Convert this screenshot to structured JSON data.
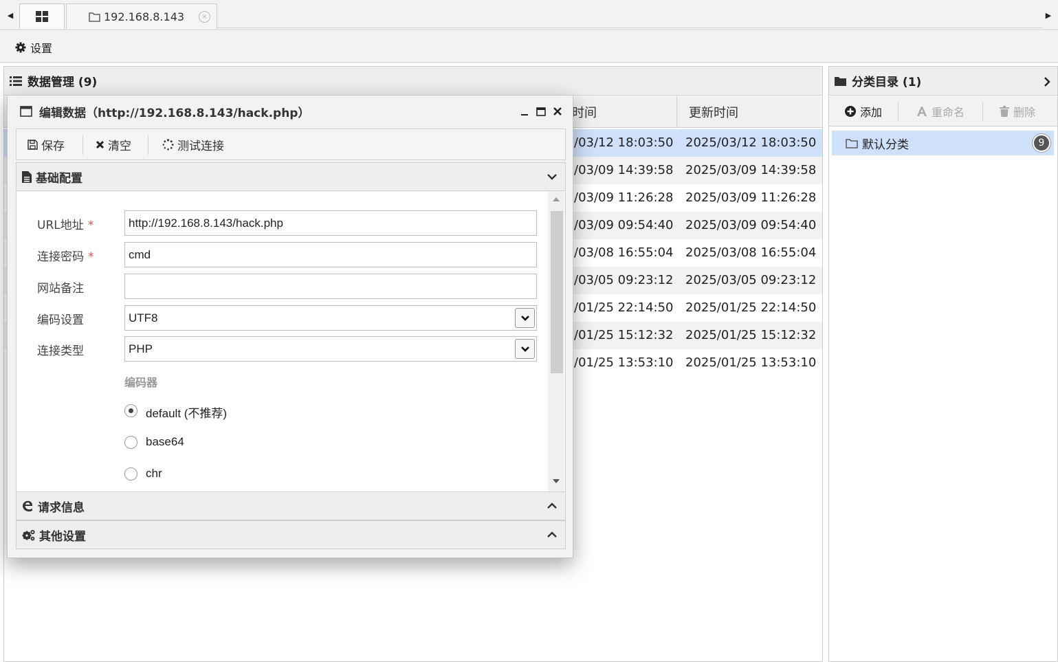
{
  "tabs": {
    "home_icon": "grid-icon",
    "host_label": "192.168.8.143",
    "close_symbol": "×"
  },
  "settings": {
    "label": "设置"
  },
  "data_panel": {
    "title": "数据管理 (9)",
    "col_created_partial": "时间",
    "col_updated": "更新时间",
    "rows": [
      {
        "created": "/03/12 18:03:50",
        "updated": "2025/03/12 18:03:50",
        "selected": true
      },
      {
        "created": "/03/09 14:39:58",
        "updated": "2025/03/09 14:39:58"
      },
      {
        "created": "/03/09 11:26:28",
        "updated": "2025/03/09 11:26:28"
      },
      {
        "created": "/03/09 09:54:40",
        "updated": "2025/03/09 09:54:40"
      },
      {
        "created": "/03/08 16:55:04",
        "updated": "2025/03/08 16:55:04"
      },
      {
        "created": "/03/05 09:23:12",
        "updated": "2025/03/05 09:23:12"
      },
      {
        "created": "/01/25 22:14:50",
        "updated": "2025/01/25 22:14:50"
      },
      {
        "created": "/01/25 15:12:32",
        "updated": "2025/01/25 15:12:32"
      },
      {
        "created": "/01/25 13:53:10",
        "updated": "2025/01/25 13:53:10"
      }
    ]
  },
  "category_panel": {
    "title": "分类目录 (1)",
    "add_label": "添加",
    "rename_label": "重命名",
    "delete_label": "删除",
    "items": [
      {
        "label": "默认分类",
        "count": "9"
      }
    ]
  },
  "dialog": {
    "title": "编辑数据（http://192.168.8.143/hack.php）",
    "save_label": "保存",
    "clear_label": "清空",
    "test_label": "测试连接",
    "section_basic": "基础配置",
    "section_request": "请求信息",
    "section_other": "其他设置",
    "url_label": "URL地址",
    "url_value": "http://192.168.8.143/hack.php",
    "password_label": "连接密码",
    "password_value": "cmd",
    "note_label": "网站备注",
    "note_value": "",
    "encoding_label": "编码设置",
    "encoding_value": "UTF8",
    "type_label": "连接类型",
    "type_value": "PHP",
    "encoder_heading": "编码器",
    "encoders": [
      {
        "label": "default (不推荐)",
        "checked": true
      },
      {
        "label": "base64",
        "checked": false
      },
      {
        "label": "chr",
        "checked": false
      }
    ],
    "required_mark": "*"
  }
}
